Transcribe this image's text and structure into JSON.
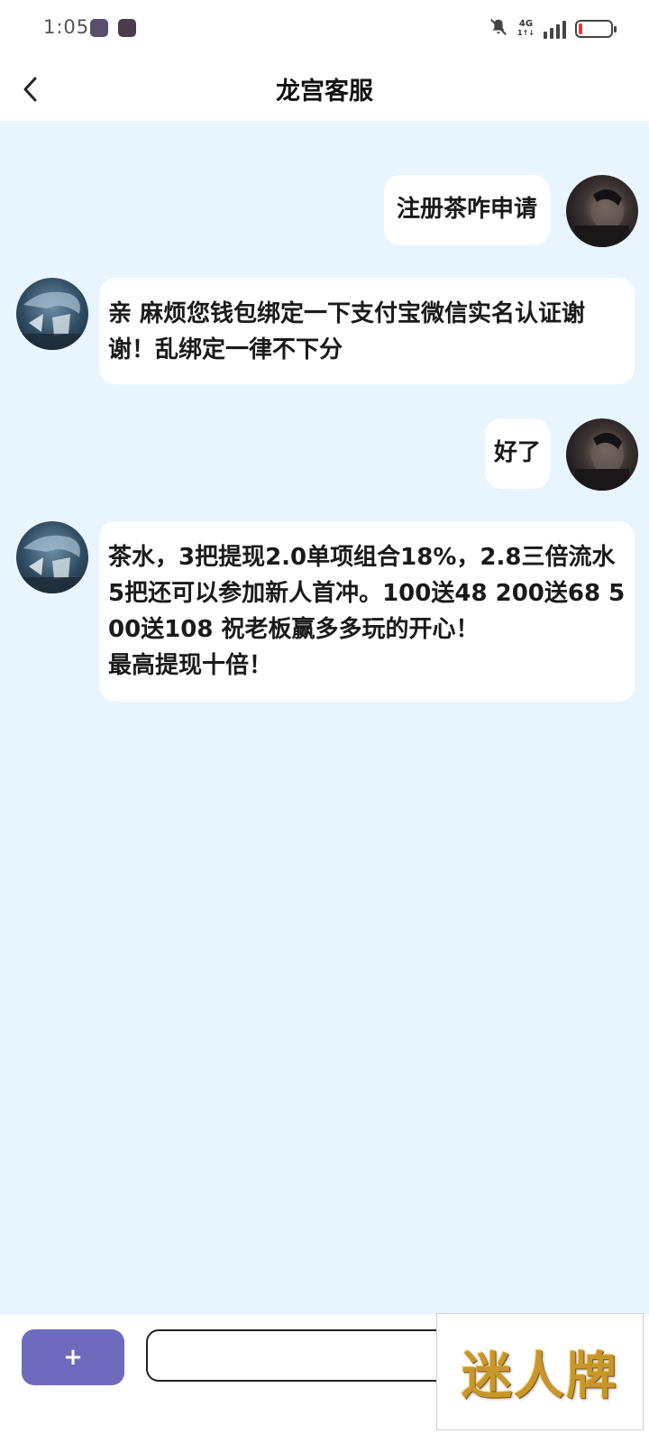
{
  "status_bar": {
    "time": "1:05",
    "network_label_top": "4G",
    "network_label_bottom": "1↑↓"
  },
  "header": {
    "title": "龙宫客服"
  },
  "chat": {
    "messages": [
      {
        "sender": "user",
        "lines": [
          "注册茶咋申请"
        ]
      },
      {
        "sender": "service",
        "lines": [
          "亲 麻烦您钱包绑定一下支付宝微信实名认证谢",
          "谢！乱绑定一律不下分"
        ]
      },
      {
        "sender": "user",
        "lines": [
          "好了"
        ]
      },
      {
        "sender": "service",
        "lines": [
          "茶水，3把提现2.0单项组合18%，2.8三倍流水",
          "5把还可以参加新人首冲。100送48 200送68 5",
          "00送108 祝老板赢多多玩的开心！",
          "最高提现十倍！"
        ]
      }
    ]
  },
  "composer": {
    "plus_label": "+",
    "input_value": "",
    "input_placeholder": ""
  },
  "watermark": {
    "text": "迷人牌"
  },
  "colors": {
    "chat_background": "#e9f5fe",
    "accent_button": "#6e6bbd",
    "battery_low": "#e53935"
  }
}
